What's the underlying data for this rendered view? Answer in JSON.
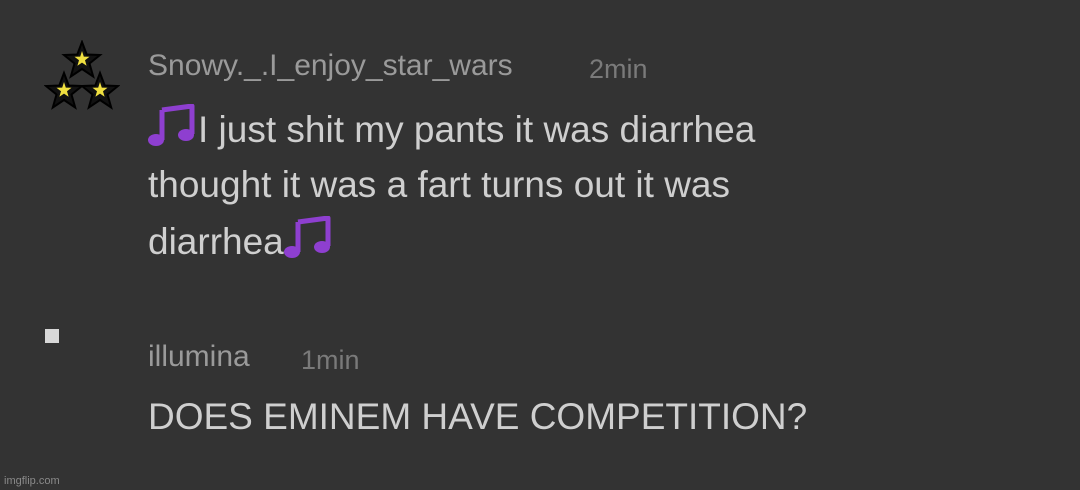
{
  "comments": [
    {
      "username": "Snowy._.I_enjoy_star_wars",
      "time": "2min",
      "avatar_icon": "three-stars-icon",
      "lines": [
        {
          "prefix_icon": "music-notes-icon",
          "text": "I just shit my pants it was diarrhea"
        },
        {
          "text": "thought it was a fart turns out it was"
        },
        {
          "text": "diarrhea",
          "suffix_icon": "music-notes-icon"
        }
      ]
    },
    {
      "username": "illumina",
      "time": "1min",
      "avatar_icon": "square-icon",
      "lines": [
        {
          "text": "DOES EMINEM HAVE COMPETITION?"
        }
      ]
    }
  ],
  "watermark": "imgflip.com",
  "colors": {
    "background": "#333333",
    "username": "#9a9a9a",
    "time": "#7a7a7a",
    "body_text": "#cfcfcf",
    "music_note": "#8e3fd0",
    "star_fill": "#f0e040"
  }
}
